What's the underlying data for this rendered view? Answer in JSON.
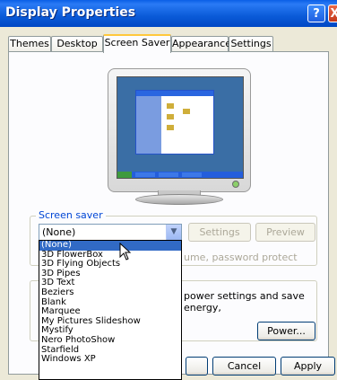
{
  "window": {
    "title": "Display Properties",
    "help_glyph": "?",
    "close_glyph": "X"
  },
  "tabs": [
    {
      "label": "Themes",
      "active": false
    },
    {
      "label": "Desktop",
      "active": false
    },
    {
      "label": "Screen Saver",
      "active": true
    },
    {
      "label": "Appearance",
      "active": false
    },
    {
      "label": "Settings",
      "active": false
    }
  ],
  "screen_saver": {
    "group_label": "Screen saver",
    "selected_value": "(None)",
    "settings_label": "Settings",
    "preview_label": "Preview",
    "wait_text": "ume, password protect"
  },
  "monitor_power": {
    "text": "power settings and save energy,",
    "power_button_label": "Power..."
  },
  "dropdown_options": [
    "(None)",
    "3D FlowerBox",
    "3D Flying Objects",
    "3D Pipes",
    "3D Text",
    "Beziers",
    "Blank",
    "Marquee",
    "My Pictures Slideshow",
    "Mystify",
    "Nero PhotoShow",
    "Starfield",
    "Windows XP"
  ],
  "dialog_buttons": {
    "cancel_label": "Cancel",
    "apply_label": "Apply"
  },
  "colors": {
    "titlebar_blue": "#0A5BD8",
    "selection_blue": "#316AC5",
    "tab_highlight": "#FFC83C"
  }
}
